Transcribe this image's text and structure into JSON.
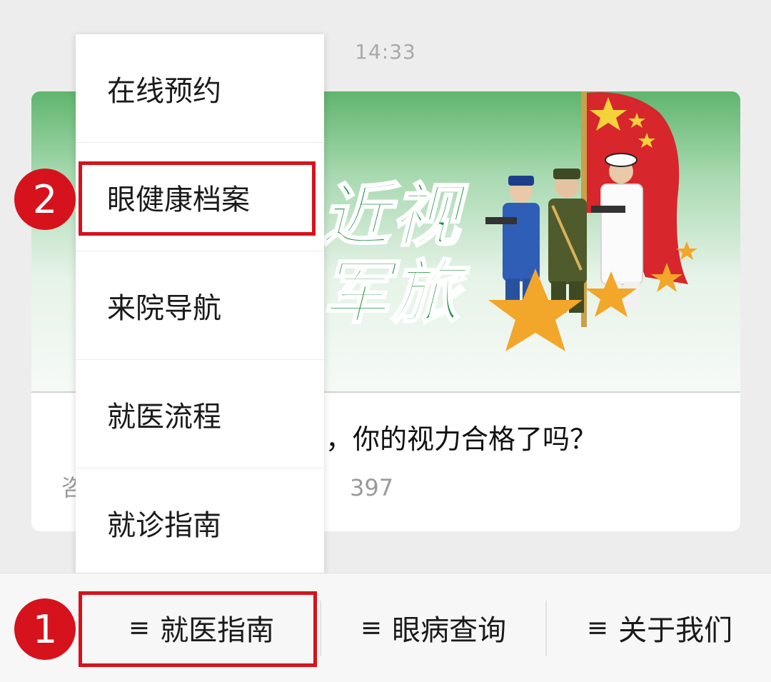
{
  "status": {
    "time": "14:33"
  },
  "article": {
    "banner_line1": "近视",
    "banner_line2": "军旅",
    "title": "，你的视力合格了吗？",
    "subtitle_start": "咨",
    "subtitle_end": "397"
  },
  "menu": {
    "items": [
      {
        "label": "在线预约"
      },
      {
        "label": "眼健康档案"
      },
      {
        "label": "来院导航"
      },
      {
        "label": "就医流程"
      },
      {
        "label": "就诊指南"
      }
    ]
  },
  "tabbar": {
    "tabs": [
      {
        "icon": "≡",
        "label": "就医指南"
      },
      {
        "icon": "≡",
        "label": "眼病查询"
      },
      {
        "icon": "≡",
        "label": "关于我们"
      }
    ]
  },
  "annotations": {
    "step1": "1",
    "step2": "2",
    "highlight_color": "#d6121c"
  },
  "colors": {
    "banner_green": "#178a3c",
    "flag_red": "#d7262c",
    "star_gold": "#f2a62a"
  }
}
